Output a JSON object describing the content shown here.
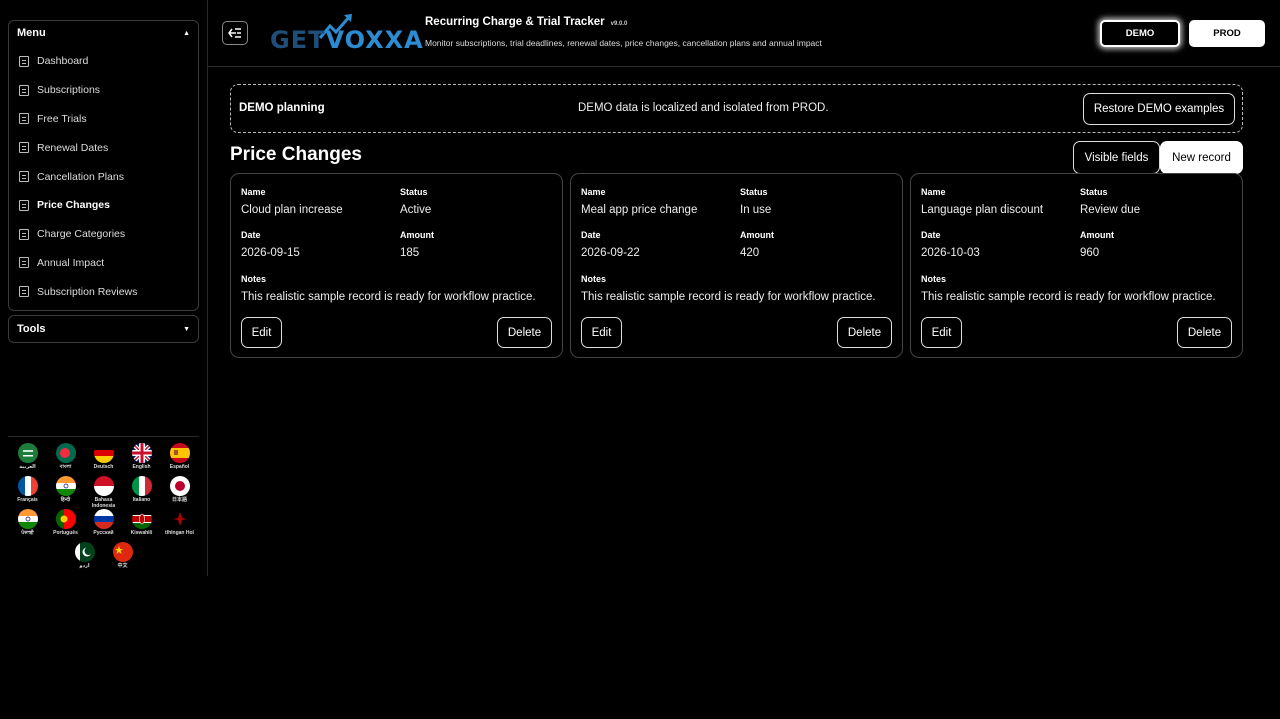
{
  "sidebar": {
    "menu_title": "Menu",
    "menu_items": [
      {
        "label": "Dashboard"
      },
      {
        "label": "Subscriptions"
      },
      {
        "label": "Free Trials"
      },
      {
        "label": "Renewal Dates"
      },
      {
        "label": "Cancellation Plans"
      },
      {
        "label": "Price Changes",
        "active": true
      },
      {
        "label": "Charge Categories"
      },
      {
        "label": "Annual Impact"
      },
      {
        "label": "Subscription Reviews"
      }
    ],
    "tools_title": "Tools",
    "languages": [
      {
        "label": "العربية",
        "flag": "saudi-arabia-flag"
      },
      {
        "label": "বাংলা",
        "flag": "bangladesh-flag"
      },
      {
        "label": "Deutsch",
        "flag": "germany-flag"
      },
      {
        "label": "English",
        "flag": "uk-flag"
      },
      {
        "label": "Español",
        "flag": "spain-flag"
      },
      {
        "label": "Français",
        "flag": "france-flag"
      },
      {
        "label": "हिन्दी",
        "flag": "india-flag"
      },
      {
        "label": "Bahasa Indonesia",
        "flag": "indonesia-flag"
      },
      {
        "label": "Italiano",
        "flag": "italy-flag"
      },
      {
        "label": "日本語",
        "flag": "japan-flag"
      },
      {
        "label": "ਪੰਜਾਬੀ",
        "flag": "india-flag"
      },
      {
        "label": "Português",
        "flag": "portugal-flag"
      },
      {
        "label": "Русский",
        "flag": "russia-flag"
      },
      {
        "label": "Kiswahili",
        "flag": "kenya-flag"
      },
      {
        "label": "tlhIngan Hol",
        "flag": "klingon-emblem"
      },
      {
        "label": "اردو",
        "flag": "pakistan-flag"
      },
      {
        "label": "中文",
        "flag": "china-flag"
      }
    ]
  },
  "header": {
    "logo_text_1": "GET",
    "logo_text_2": "VOXXA",
    "title": "Recurring Charge & Trial Tracker",
    "version": "v9.0.0",
    "subtitle": "Monitor subscriptions, trial deadlines, renewal dates, price changes, cancellation plans and annual impact",
    "demo_label": "DEMO",
    "prod_label": "PROD"
  },
  "notice": {
    "title": "DEMO planning",
    "text": "DEMO data is localized and isolated from PROD.",
    "restore_label": "Restore DEMO examples"
  },
  "main": {
    "title": "Price Changes",
    "visible_fields_label": "Visible fields",
    "new_record_label": "New record",
    "labels": {
      "name": "Name",
      "status": "Status",
      "date": "Date",
      "amount": "Amount",
      "notes": "Notes"
    },
    "edit_label": "Edit",
    "delete_label": "Delete",
    "cards": [
      {
        "name": "Cloud plan increase",
        "status": "Active",
        "date": "2026-09-15",
        "amount": "185",
        "notes": "This realistic sample record is ready for workflow practice."
      },
      {
        "name": "Meal app price change",
        "status": "In use",
        "date": "2026-09-22",
        "amount": "420",
        "notes": "This realistic sample record is ready for workflow practice."
      },
      {
        "name": "Language plan discount",
        "status": "Review due",
        "date": "2026-10-03",
        "amount": "960",
        "notes": "This realistic sample record is ready for workflow practice."
      }
    ]
  }
}
